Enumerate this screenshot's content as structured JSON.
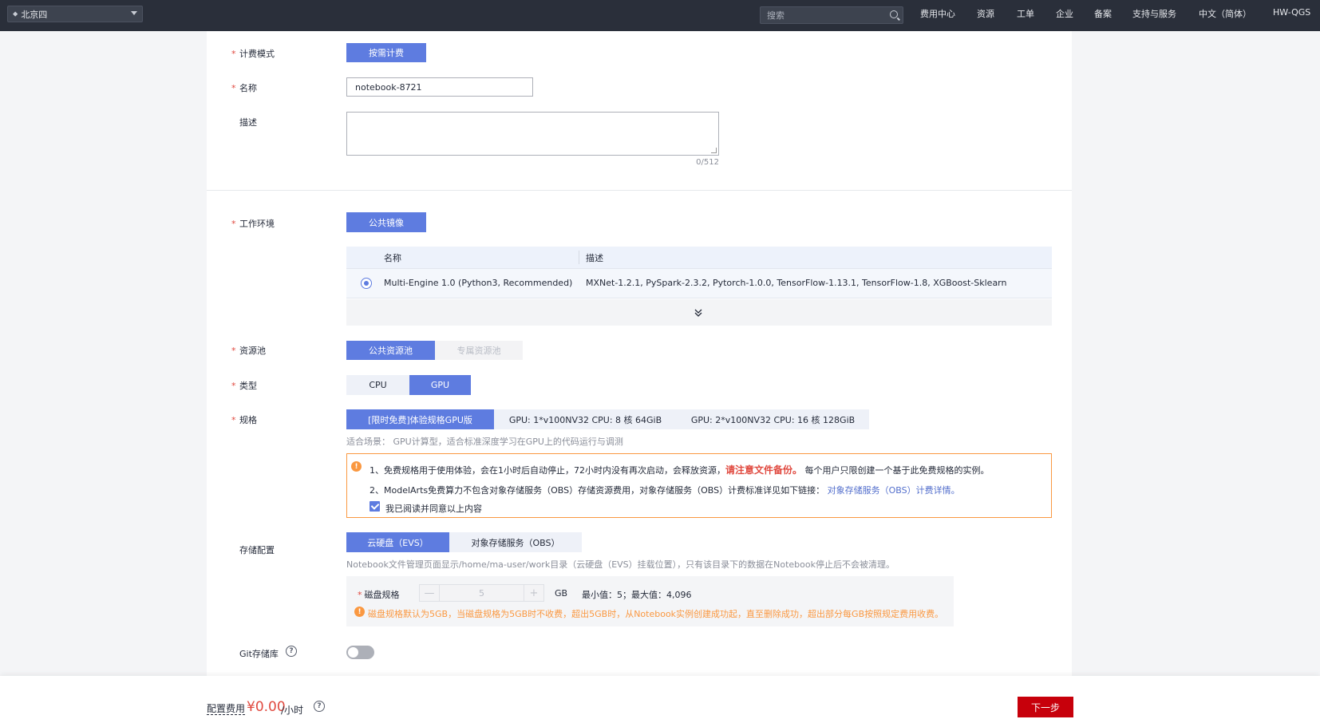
{
  "topbar": {
    "region": "北京四",
    "search_placeholder": "搜索",
    "nav": [
      "费用中心",
      "资源",
      "工单",
      "企业",
      "备案",
      "支持与服务",
      "中文（简体）",
      "HW-QGS"
    ]
  },
  "form": {
    "billing": {
      "label": "计费模式",
      "option": "按需计费"
    },
    "name": {
      "label": "名称",
      "value": "notebook-8721"
    },
    "description": {
      "label": "描述",
      "counter": "0/512"
    },
    "work_env": {
      "label": "工作环境",
      "option": "公共镜像",
      "table": {
        "headers": [
          "名称",
          "描述"
        ],
        "rows": [
          {
            "name": "Multi-Engine 1.0 (Python3, Recommended)",
            "desc": "MXNet-1.2.1, PySpark-2.3.2, Pytorch-1.0.0, TensorFlow-1.13.1, TensorFlow-1.8, XGBoost-Sklearn",
            "selected": true
          }
        ]
      }
    },
    "pool": {
      "label": "资源池",
      "options": [
        "公共资源池",
        "专属资源池"
      ]
    },
    "type": {
      "label": "类型",
      "options": [
        "CPU",
        "GPU"
      ]
    },
    "spec": {
      "label": "规格",
      "options": [
        "[限时免费]体验规格GPU版",
        "GPU: 1*v100NV32 CPU: 8 核 64GiB",
        "GPU: 2*v100NV32 CPU: 16 核 128GiB"
      ],
      "hint": "适合场景： GPU计算型，适合标准深度学习在GPU上的代码运行与调测"
    },
    "warning": {
      "line1_a": "1、免费规格用于使用体验，会在1小时后自动停止，72小时内没有再次启动，会释放资源，",
      "line1_red": "请注意文件备份。",
      "line1_b": "每个用户只限创建一个基于此免费规格的实例。",
      "line2_a": "2、ModelArts免费算力不包含对象存储服务（OBS）存储资源费用，对象存储服务（OBS）计费标准详见如下链接：",
      "line2_link": "对象存储服务（OBS）计费详情。",
      "agree": "我已阅读并同意以上内容"
    },
    "storage": {
      "label": "存储配置",
      "options": [
        "云硬盘（EVS）",
        "对象存储服务（OBS）"
      ],
      "hint": "Notebook文件管理页面显示/home/ma-user/work目录（云硬盘（EVS）挂载位置），只有该目录下的数据在Notebook停止后不会被清理。",
      "disk": {
        "label": "磁盘规格",
        "minus": "—",
        "value": "5",
        "plus": "+",
        "unit": "GB",
        "range": "最小值：5；最大值：4,096",
        "note": "磁盘规格默认为5GB，当磁盘规格为5GB时不收费，超出5GB时，从Notebook实例创建成功起，直至删除成功，超出部分每GB按照规定费用收费。"
      }
    },
    "git": {
      "label": "Git存储库"
    }
  },
  "footer": {
    "fee_label": "配置费用",
    "fee_value": "¥0.00",
    "fee_unit": "/小时",
    "next": "下一步"
  },
  "colors": {
    "primary": "#5e7ce0",
    "danger": "#e0493f",
    "warning": "#fa9841",
    "cta": "#c7000b",
    "topbar": "#2a2f3a"
  }
}
